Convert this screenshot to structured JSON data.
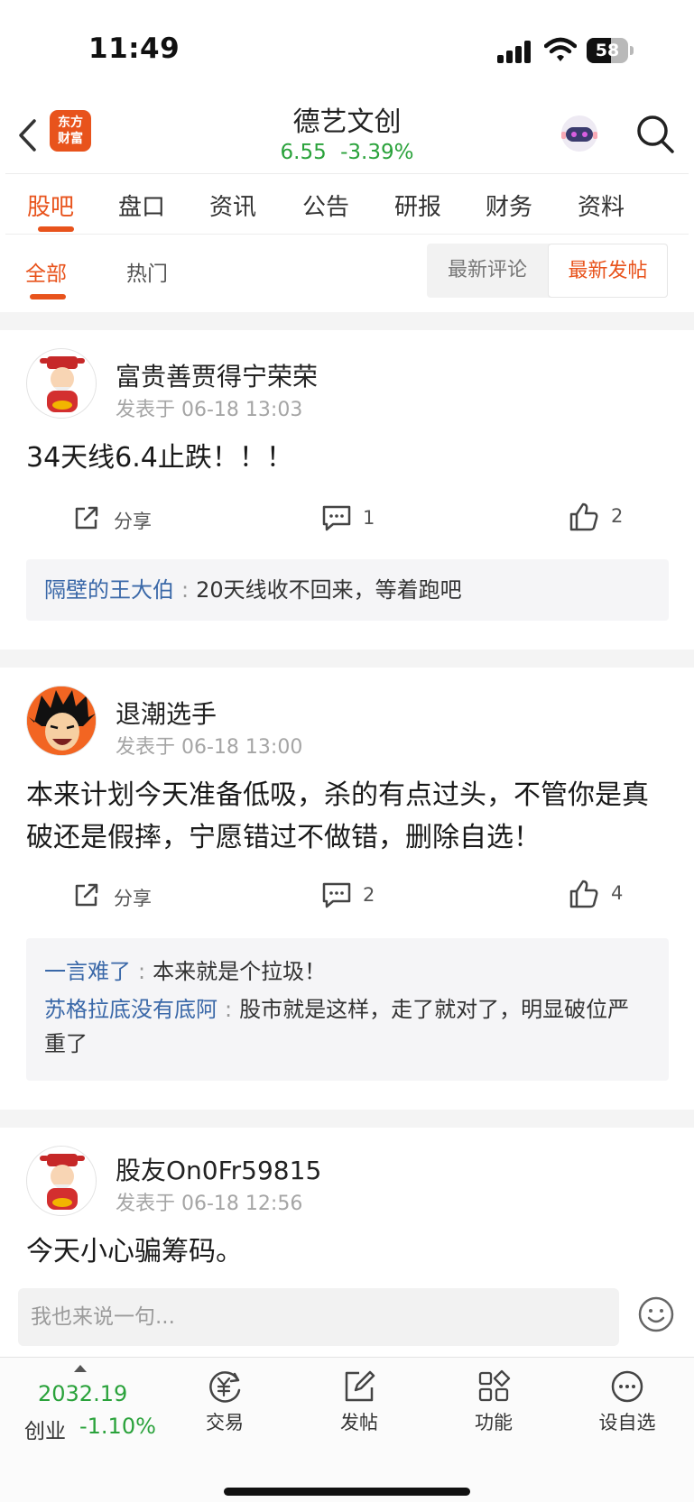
{
  "status_bar": {
    "time": "11:49",
    "battery": "58",
    "battery_level": 0.58
  },
  "header": {
    "logo_text": "东方\n财富",
    "stock_name": "德艺文创",
    "price": "6.55",
    "change_pct": "-3.39%"
  },
  "tabs": [
    "股吧",
    "盘口",
    "资讯",
    "公告",
    "研报",
    "财务",
    "资料"
  ],
  "active_tab": "股吧",
  "filters": {
    "all": "全部",
    "hot": "热门",
    "sort_comment": "最新评论",
    "sort_post": "最新发帖"
  },
  "posts": [
    {
      "author": "富贵善贾得宁荣荣",
      "time": "发表于 06-18 13:03",
      "content": "34天线6.4止跌！！！",
      "share": "分享",
      "comments": "1",
      "likes": "2",
      "replies": [
        {
          "user": "隔壁的王大伯",
          "text": "20天线收不回来，等着跑吧"
        }
      ]
    },
    {
      "author": "退潮选手",
      "time": "发表于 06-18 13:00",
      "content": "本来计划今天准备低吸，杀的有点过头，不管你是真破还是假摔，宁愿错过不做错，删除自选！",
      "share": "分享",
      "comments": "2",
      "likes": "4",
      "replies": [
        {
          "user": "一言难了",
          "text": "本来就是个拉圾！"
        },
        {
          "user": "苏格拉底没有底阿",
          "text": "股市就是这样，走了就对了，明显破位严重了"
        }
      ]
    },
    {
      "author": "股友On0Fr59815",
      "time": "发表于 06-18 12:56",
      "content": "今天小心骗筹码。"
    }
  ],
  "input": {
    "placeholder": "我也来说一句..."
  },
  "bottom_bar": {
    "index_value": "2032.19",
    "index_name": "创业",
    "index_change": "-1.10%",
    "items": [
      "交易",
      "发帖",
      "功能",
      "设自选"
    ]
  },
  "colors": {
    "accent": "#e8531c",
    "down": "#2aa23b",
    "link": "#3a68a8"
  }
}
